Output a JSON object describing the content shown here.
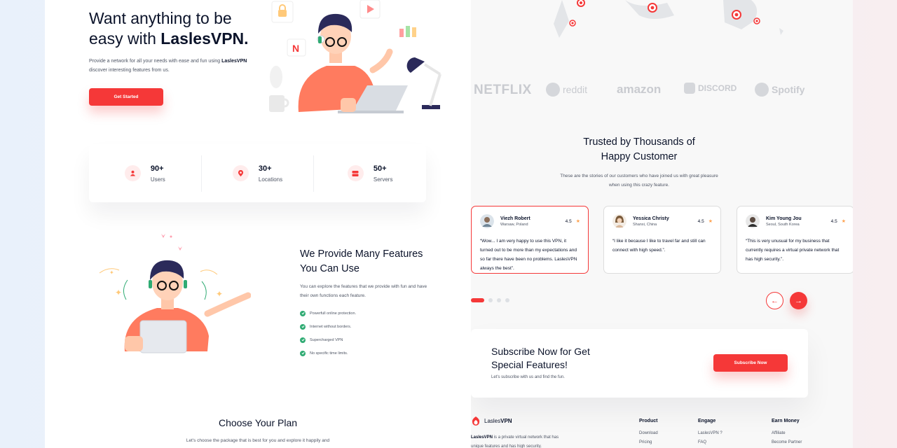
{
  "hero": {
    "title_prefix": "Want anything to be easy with ",
    "title_brand": "LaslesVPN.",
    "desc_prefix": "Provide a network for all your needs with ease and fun using ",
    "desc_brand": "LaslesVPN",
    "desc_suffix": " discover interesting features from us.",
    "cta": "Get Started"
  },
  "stats": [
    {
      "value": "90+",
      "label": "Users",
      "icon": "user-icon"
    },
    {
      "value": "30+",
      "label": "Locations",
      "icon": "location-pin-icon"
    },
    {
      "value": "50+",
      "label": "Servers",
      "icon": "server-icon"
    }
  ],
  "features": {
    "title": "We Provide Many Features You Can Use",
    "desc": "You can explore the features that we provide with fun and have their own functions each feature.",
    "items": [
      "Powerfull online protection.",
      "Internet without borders.",
      "Supercharged VPN",
      "No specific time limits."
    ]
  },
  "plan": {
    "title": "Choose Your Plan",
    "desc": "Let's choose the package that is best for you and explore it happily and"
  },
  "brands": [
    "NETFLIX",
    "reddit",
    "amazon",
    "DISCORD",
    "Spotify"
  ],
  "testimonials": {
    "title": "Trusted by Thousands of Happy Customer",
    "desc": "These are the stories of our customers who have joined us with great pleasure when using this crazy feature.",
    "cards": [
      {
        "name": "Viezh Robert",
        "location": "Warsaw, Poland",
        "rating": "4.5",
        "text": "“Wow... I am very happy to use this VPN, it turned out to be more than my expectations and so far there have been no problems. LaslesVPN always the best”.",
        "active": true
      },
      {
        "name": "Yessica Christy",
        "location": "Shanxi, China",
        "rating": "4.5",
        "text": "“I like it because I like to travel far and still can connect with high speed.”.",
        "active": false
      },
      {
        "name": "Kim Young Jou",
        "location": "Seoul, South Korea",
        "rating": "4.5",
        "text": "“This is very unusual for my business that currently requires a virtual private network that has high security.”.",
        "active": false
      }
    ],
    "prev_icon": "←",
    "next_icon": "→"
  },
  "subscribe": {
    "title": "Subscribe Now for Get Special Features!",
    "desc": "Let's subscribe with us and find the fun.",
    "button": "Subscribe Now"
  },
  "footer": {
    "brand_light": "Lasles",
    "brand_bold": "VPN",
    "desc_brand": "LaslesVPN",
    "desc_rest": " is a private virtual network that has unique features and has high security.",
    "columns": [
      {
        "title": "Product",
        "items": [
          "Download",
          "Pricing"
        ]
      },
      {
        "title": "Engage",
        "items": [
          "LaslesVPN ?",
          "FAQ"
        ]
      },
      {
        "title": "Earn Money",
        "items": [
          "Affiliate",
          "Become Partner"
        ]
      }
    ]
  },
  "colors": {
    "accent": "#f53838",
    "dark": "#0b132a",
    "muted": "#4f5665",
    "success": "#2fab73"
  }
}
